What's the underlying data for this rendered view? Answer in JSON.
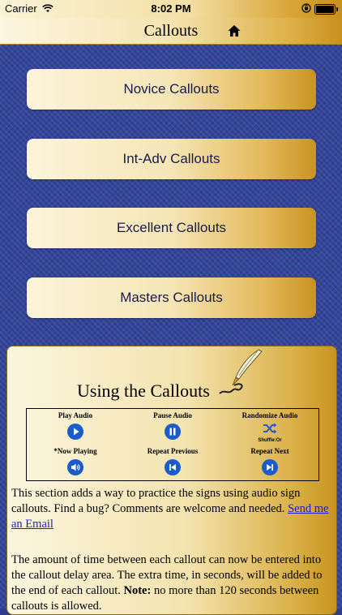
{
  "status_bar": {
    "carrier": "Carrier",
    "time": "8:02 PM"
  },
  "nav": {
    "title": "Callouts",
    "home_icon": "home-icon"
  },
  "menu": [
    {
      "label": "Novice Callouts"
    },
    {
      "label": "Int-Adv Callouts"
    },
    {
      "label": "Excellent Callouts"
    },
    {
      "label": "Masters Callouts"
    }
  ],
  "info": {
    "title": "Using the Callouts",
    "controls": {
      "play_label": "Play Audio",
      "pause_label": "Pause Audio",
      "randomize_label": "Randomize Audio",
      "shuffle_text": "Shuffle:Or",
      "now_playing_label": "*Now Playing",
      "repeat_previous_label": "Repeat Previous",
      "repeat_next_label": "Repeat Next"
    },
    "paragraph1": "This section adds a way to practice the signs using audio sign callouts. Find a bug? Comments are welcome and needed. ",
    "email_link": "Send me an Email",
    "paragraph2_a": "The amount of time between each callout can now be entered into the callout delay area. The extra time, in seconds, will be added to the end of each callout. ",
    "paragraph2_note": "Note:",
    "paragraph2_b": " no more than 120 seconds between callouts is allowed."
  },
  "colors": {
    "background": "#33449a",
    "gold": "#c99222",
    "cream": "#fcf4da",
    "icon_blue": "#1c5cc8"
  }
}
